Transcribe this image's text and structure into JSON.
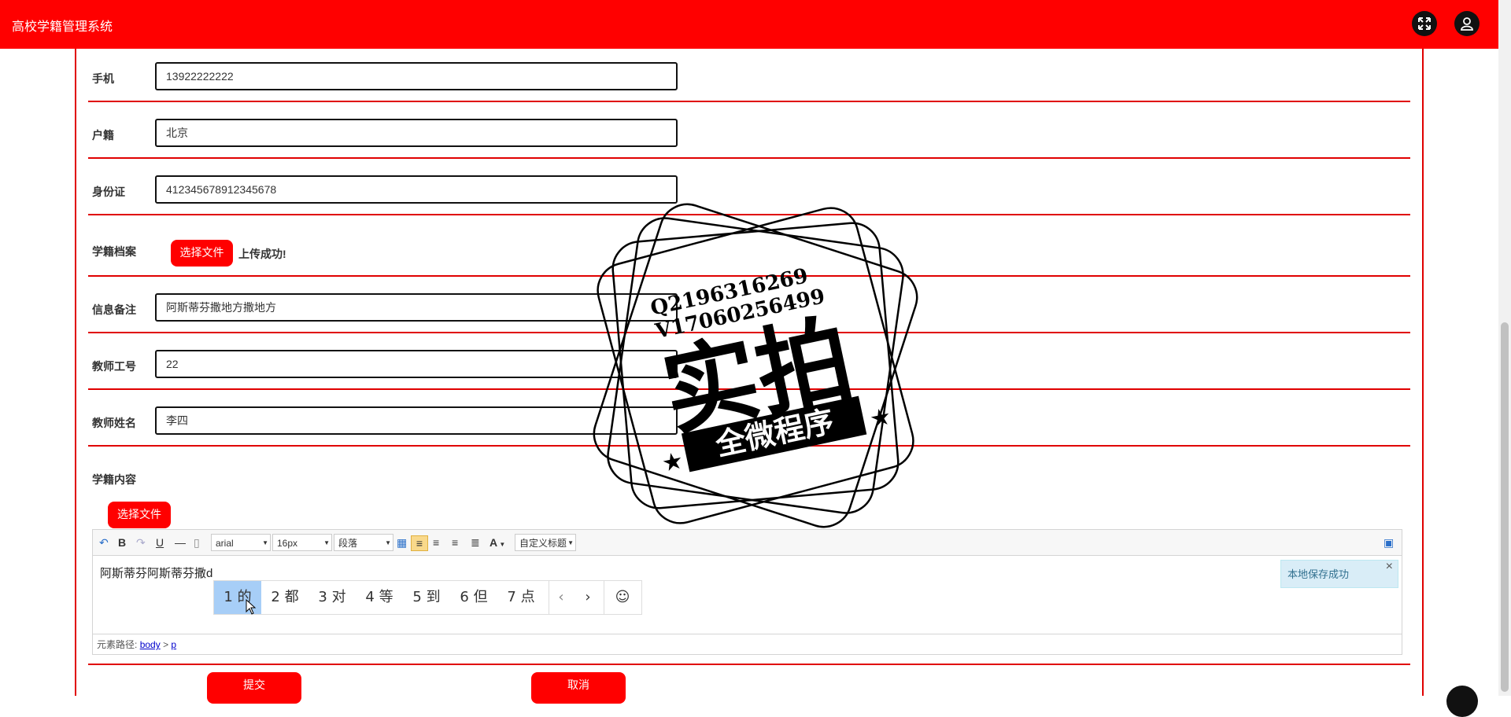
{
  "header": {
    "title": "高校学籍管理系统"
  },
  "form": {
    "phone": {
      "label": "手机",
      "value": "13922222222"
    },
    "hukou": {
      "label": "户籍",
      "value": "北京"
    },
    "idcard": {
      "label": "身份证",
      "value": "412345678912345678"
    },
    "archive": {
      "label": "学籍档案",
      "button": "选择文件",
      "status": "上传成功!"
    },
    "remark": {
      "label": "信息备注",
      "value": "阿斯蒂芬撒地方撒地方"
    },
    "teacher_id": {
      "label": "教师工号",
      "value": "22"
    },
    "teacher_name": {
      "label": "教师姓名",
      "value": "李四"
    },
    "content": {
      "label": "学籍内容",
      "button": "选择文件"
    },
    "submit": "提交",
    "cancel": "取消"
  },
  "editor": {
    "font": "arial",
    "size": "16px",
    "para": "段落",
    "custom_title": "自定义标题",
    "bold": "B",
    "underline": "U",
    "font_color": "A",
    "text": "阿斯蒂芬阿斯蒂芬撒d",
    "path_label": "元素路径:",
    "path_body": "body",
    "path_sep": ">",
    "path_p": "p",
    "toast": "本地保存成功",
    "toast_close": "×"
  },
  "ime": {
    "candidates": [
      "1 的",
      "2 都",
      "3 对",
      "4 等",
      "5 到",
      "6 但",
      "7 点"
    ],
    "prev": "‹",
    "next": "›",
    "emoji": "☺"
  },
  "watermark": {
    "contact_q": "Q2196316269",
    "contact_v": "V17060256499",
    "main": "实拍",
    "banner": "全微程序"
  },
  "colors": {
    "primary": "#ff0000",
    "accent_line": "#e00000"
  }
}
